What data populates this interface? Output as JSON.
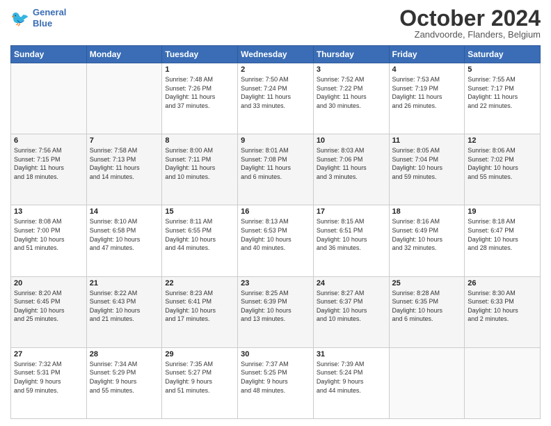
{
  "header": {
    "logo_line1": "General",
    "logo_line2": "Blue",
    "month_title": "October 2024",
    "subtitle": "Zandvoorde, Flanders, Belgium"
  },
  "days_of_week": [
    "Sunday",
    "Monday",
    "Tuesday",
    "Wednesday",
    "Thursday",
    "Friday",
    "Saturday"
  ],
  "weeks": [
    [
      {
        "day": "",
        "text": ""
      },
      {
        "day": "",
        "text": ""
      },
      {
        "day": "1",
        "text": "Sunrise: 7:48 AM\nSunset: 7:26 PM\nDaylight: 11 hours\nand 37 minutes."
      },
      {
        "day": "2",
        "text": "Sunrise: 7:50 AM\nSunset: 7:24 PM\nDaylight: 11 hours\nand 33 minutes."
      },
      {
        "day": "3",
        "text": "Sunrise: 7:52 AM\nSunset: 7:22 PM\nDaylight: 11 hours\nand 30 minutes."
      },
      {
        "day": "4",
        "text": "Sunrise: 7:53 AM\nSunset: 7:19 PM\nDaylight: 11 hours\nand 26 minutes."
      },
      {
        "day": "5",
        "text": "Sunrise: 7:55 AM\nSunset: 7:17 PM\nDaylight: 11 hours\nand 22 minutes."
      }
    ],
    [
      {
        "day": "6",
        "text": "Sunrise: 7:56 AM\nSunset: 7:15 PM\nDaylight: 11 hours\nand 18 minutes."
      },
      {
        "day": "7",
        "text": "Sunrise: 7:58 AM\nSunset: 7:13 PM\nDaylight: 11 hours\nand 14 minutes."
      },
      {
        "day": "8",
        "text": "Sunrise: 8:00 AM\nSunset: 7:11 PM\nDaylight: 11 hours\nand 10 minutes."
      },
      {
        "day": "9",
        "text": "Sunrise: 8:01 AM\nSunset: 7:08 PM\nDaylight: 11 hours\nand 6 minutes."
      },
      {
        "day": "10",
        "text": "Sunrise: 8:03 AM\nSunset: 7:06 PM\nDaylight: 11 hours\nand 3 minutes."
      },
      {
        "day": "11",
        "text": "Sunrise: 8:05 AM\nSunset: 7:04 PM\nDaylight: 10 hours\nand 59 minutes."
      },
      {
        "day": "12",
        "text": "Sunrise: 8:06 AM\nSunset: 7:02 PM\nDaylight: 10 hours\nand 55 minutes."
      }
    ],
    [
      {
        "day": "13",
        "text": "Sunrise: 8:08 AM\nSunset: 7:00 PM\nDaylight: 10 hours\nand 51 minutes."
      },
      {
        "day": "14",
        "text": "Sunrise: 8:10 AM\nSunset: 6:58 PM\nDaylight: 10 hours\nand 47 minutes."
      },
      {
        "day": "15",
        "text": "Sunrise: 8:11 AM\nSunset: 6:55 PM\nDaylight: 10 hours\nand 44 minutes."
      },
      {
        "day": "16",
        "text": "Sunrise: 8:13 AM\nSunset: 6:53 PM\nDaylight: 10 hours\nand 40 minutes."
      },
      {
        "day": "17",
        "text": "Sunrise: 8:15 AM\nSunset: 6:51 PM\nDaylight: 10 hours\nand 36 minutes."
      },
      {
        "day": "18",
        "text": "Sunrise: 8:16 AM\nSunset: 6:49 PM\nDaylight: 10 hours\nand 32 minutes."
      },
      {
        "day": "19",
        "text": "Sunrise: 8:18 AM\nSunset: 6:47 PM\nDaylight: 10 hours\nand 28 minutes."
      }
    ],
    [
      {
        "day": "20",
        "text": "Sunrise: 8:20 AM\nSunset: 6:45 PM\nDaylight: 10 hours\nand 25 minutes."
      },
      {
        "day": "21",
        "text": "Sunrise: 8:22 AM\nSunset: 6:43 PM\nDaylight: 10 hours\nand 21 minutes."
      },
      {
        "day": "22",
        "text": "Sunrise: 8:23 AM\nSunset: 6:41 PM\nDaylight: 10 hours\nand 17 minutes."
      },
      {
        "day": "23",
        "text": "Sunrise: 8:25 AM\nSunset: 6:39 PM\nDaylight: 10 hours\nand 13 minutes."
      },
      {
        "day": "24",
        "text": "Sunrise: 8:27 AM\nSunset: 6:37 PM\nDaylight: 10 hours\nand 10 minutes."
      },
      {
        "day": "25",
        "text": "Sunrise: 8:28 AM\nSunset: 6:35 PM\nDaylight: 10 hours\nand 6 minutes."
      },
      {
        "day": "26",
        "text": "Sunrise: 8:30 AM\nSunset: 6:33 PM\nDaylight: 10 hours\nand 2 minutes."
      }
    ],
    [
      {
        "day": "27",
        "text": "Sunrise: 7:32 AM\nSunset: 5:31 PM\nDaylight: 9 hours\nand 59 minutes."
      },
      {
        "day": "28",
        "text": "Sunrise: 7:34 AM\nSunset: 5:29 PM\nDaylight: 9 hours\nand 55 minutes."
      },
      {
        "day": "29",
        "text": "Sunrise: 7:35 AM\nSunset: 5:27 PM\nDaylight: 9 hours\nand 51 minutes."
      },
      {
        "day": "30",
        "text": "Sunrise: 7:37 AM\nSunset: 5:25 PM\nDaylight: 9 hours\nand 48 minutes."
      },
      {
        "day": "31",
        "text": "Sunrise: 7:39 AM\nSunset: 5:24 PM\nDaylight: 9 hours\nand 44 minutes."
      },
      {
        "day": "",
        "text": ""
      },
      {
        "day": "",
        "text": ""
      }
    ]
  ]
}
